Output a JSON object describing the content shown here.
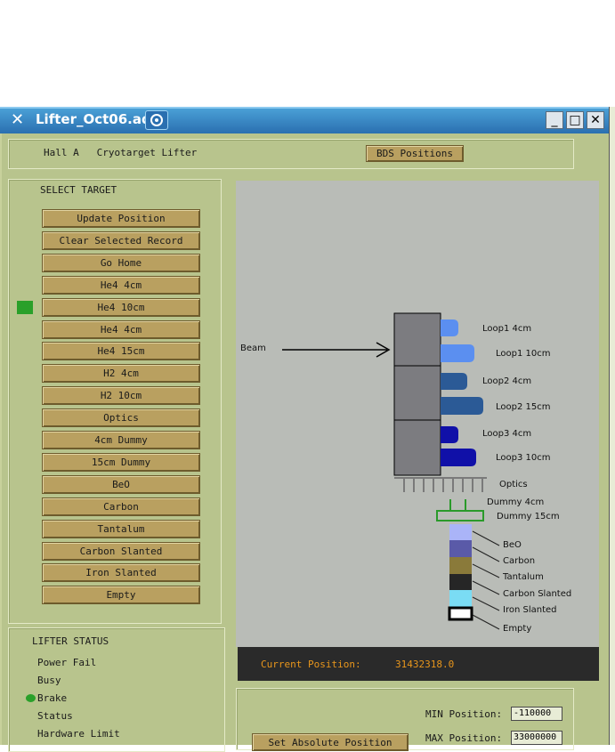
{
  "window": {
    "title": "Lifter_Oct06.adl"
  },
  "header": {
    "title": "Hall A   Cryotarget Lifter",
    "bds_button": "BDS Positions"
  },
  "select_target": {
    "heading": "SELECT TARGET",
    "buttons": [
      "Update Position",
      "Clear Selected Record",
      "Go Home",
      "He4 4cm",
      "He4 10cm",
      "He4 4cm",
      "He4 15cm",
      "H2 4cm",
      "H2 10cm",
      "Optics",
      "4cm Dummy",
      "15cm Dummy",
      "BeO",
      "Carbon",
      "Tantalum",
      "Carbon Slanted",
      "Iron Slanted",
      "Empty"
    ],
    "selected_index": 4,
    "indicator_color": "#2aa02a"
  },
  "diagram": {
    "beam_label": "Beam",
    "loop_labels": [
      "Loop1 4cm",
      "Loop1 10cm",
      "Loop2 4cm",
      "Loop2 15cm",
      "Loop3 4cm",
      "Loop3 10cm"
    ],
    "loop_colors": [
      "#5b8ff0",
      "#5b8ff0",
      "#2b5a96",
      "#2b5a96",
      "#1010a8",
      "#1010a8"
    ],
    "optics_label": "Optics",
    "dummy_labels": [
      "Dummy 4cm",
      "Dummy 15cm"
    ],
    "solid_labels": [
      "BeO",
      "Carbon",
      "Tantalum",
      "Carbon Slanted",
      "Iron Slanted",
      "Empty"
    ],
    "solid_colors": [
      "#aab4f8",
      "#5a5aa8",
      "#8a7a3a",
      "#262626",
      "#7adcf4",
      "#ffffff"
    ]
  },
  "current_position": {
    "label": "Current Position:",
    "value": "31432318.0"
  },
  "lifter_status": {
    "heading": "LIFTER STATUS",
    "items": [
      "Power Fail",
      "Busy",
      "Brake",
      "Status",
      "Hardware Limit"
    ],
    "active_index": 2,
    "active_color": "#2aa02a"
  },
  "limits": {
    "min_label": "MIN Position:",
    "min_value": "-110000",
    "max_label": "MAX Position:",
    "max_value": "33000000",
    "set_button": "Set Absolute Position"
  }
}
